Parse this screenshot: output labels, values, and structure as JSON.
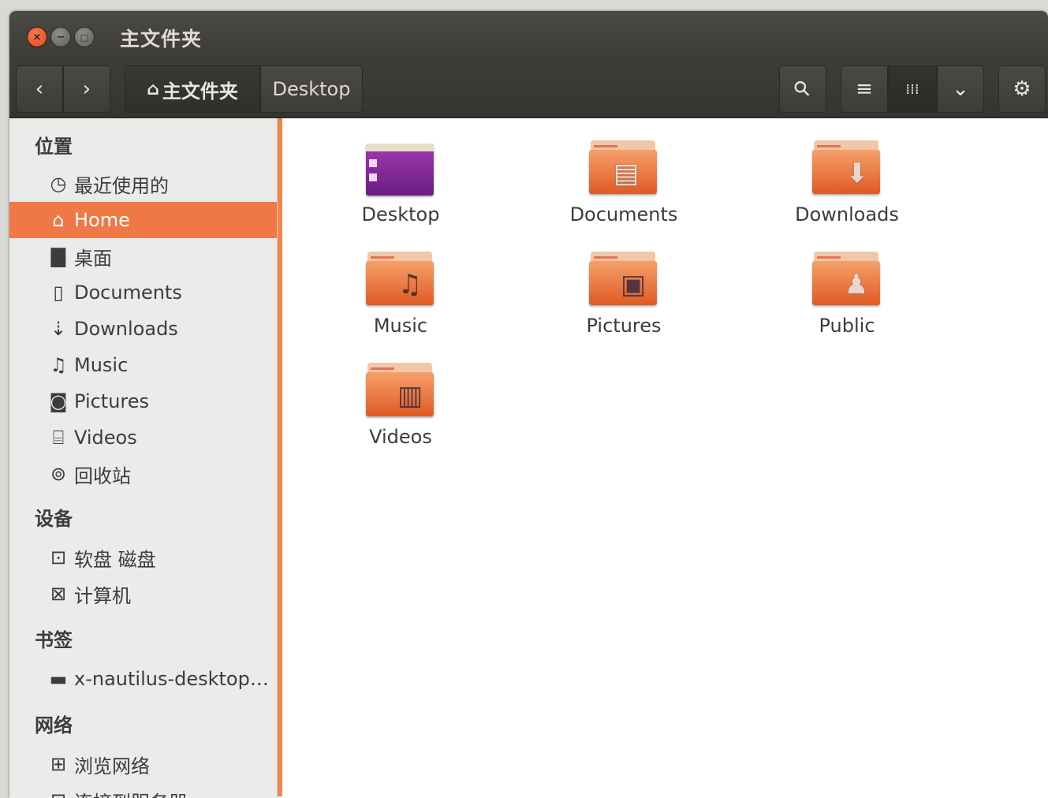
{
  "window": {
    "title": "主文件夹",
    "close_glyph": "×",
    "min_glyph": "−",
    "max_glyph": "□"
  },
  "toolbar": {
    "back_glyph": "‹",
    "forward_glyph": "›",
    "breadcrumb_home_icon": "home-icon",
    "breadcrumb_home": "主文件夹",
    "breadcrumb_current": "Desktop",
    "search_glyph": "⚲",
    "list_glyph": "≡",
    "grid_glyph": "⁞⁞⁞",
    "dropdown_glyph": "⌄",
    "settings_glyph": "⚙"
  },
  "sidebar": {
    "places_header": "位置",
    "places": [
      {
        "label": "最近使用的",
        "icon": "clock-icon",
        "glyph": "◷"
      },
      {
        "label": "Home",
        "icon": "home-icon",
        "glyph": "⌂",
        "selected": true
      },
      {
        "label": "桌面",
        "icon": "folder-icon",
        "glyph": "▇"
      },
      {
        "label": "Documents",
        "icon": "document-icon",
        "glyph": "▯"
      },
      {
        "label": "Downloads",
        "icon": "download-icon",
        "glyph": "⇣"
      },
      {
        "label": "Music",
        "icon": "music-icon",
        "glyph": "♫"
      },
      {
        "label": "Pictures",
        "icon": "camera-icon",
        "glyph": "◙"
      },
      {
        "label": "Videos",
        "icon": "film-icon",
        "glyph": "⌸"
      },
      {
        "label": "回收站",
        "icon": "trash-icon",
        "glyph": "⊚"
      }
    ],
    "devices_header": "设备",
    "devices": [
      {
        "label": "软盘 磁盘",
        "icon": "floppy-icon",
        "glyph": "⊡"
      },
      {
        "label": "计算机",
        "icon": "computer-icon",
        "glyph": "⊠"
      }
    ],
    "bookmarks_header": "书签",
    "bookmarks": [
      {
        "label": "x-nautilus-desktop…",
        "icon": "desktop-icon",
        "glyph": "▬"
      }
    ],
    "network_header": "网络",
    "network": [
      {
        "label": "浏览网络",
        "icon": "network-icon",
        "glyph": "⊞"
      },
      {
        "label": "连接到服务器",
        "icon": "server-icon",
        "glyph": "⊟"
      }
    ]
  },
  "files": [
    {
      "name": "Desktop",
      "icon": "desktop-folder-icon",
      "emblem": ""
    },
    {
      "name": "Documents",
      "icon": "documents-folder-icon",
      "emblem": "▤"
    },
    {
      "name": "Downloads",
      "icon": "downloads-folder-icon",
      "emblem": "⬇"
    },
    {
      "name": "Music",
      "icon": "music-folder-icon",
      "emblem": "♫"
    },
    {
      "name": "Pictures",
      "icon": "pictures-folder-icon",
      "emblem": "▣"
    },
    {
      "name": "Public",
      "icon": "public-folder-icon",
      "emblem": "♟"
    },
    {
      "name": "Videos",
      "icon": "videos-folder-icon",
      "emblem": "▥"
    }
  ],
  "colors": {
    "accent": "#f07746",
    "titlebar": "#3c3b37",
    "sidebar_bg": "#ebebea"
  }
}
